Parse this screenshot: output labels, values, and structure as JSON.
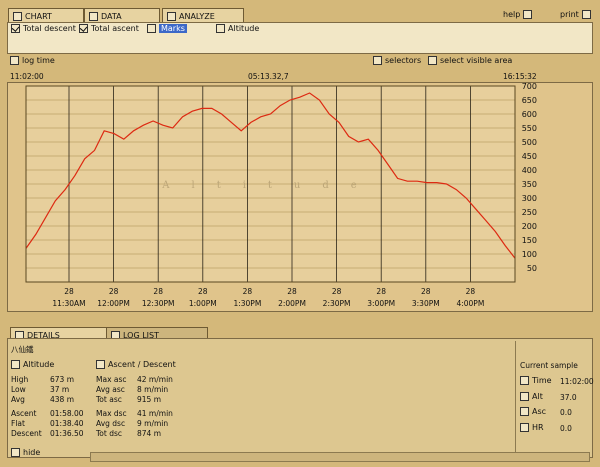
{
  "tabs": [
    {
      "label": "CHART",
      "icon": "chart-icon"
    },
    {
      "label": "DATA",
      "icon": "table-icon"
    },
    {
      "label": "ANALYZE",
      "icon": "analyze-icon"
    }
  ],
  "top_right": {
    "help": "help",
    "print": "print"
  },
  "toggles": [
    {
      "label": "Total descent"
    },
    {
      "label": "Total ascent"
    },
    {
      "label": "Marks"
    },
    {
      "label": "Altitude"
    }
  ],
  "log_time": "log time",
  "selectors": "selectors",
  "select_visible_area": "select visible area",
  "time_start": "11:02:00",
  "time_mid": "05:13.32,7",
  "time_end": "16:15:32",
  "chart_data": {
    "type": "line",
    "watermark": "Altitude",
    "series": [
      {
        "name": "Altitude",
        "color": "#dd2a12",
        "x": [
          0,
          2,
          4,
          6,
          8,
          10,
          12,
          14,
          16,
          18,
          20,
          22,
          24,
          26,
          28,
          30,
          32,
          34,
          36,
          38,
          40,
          42,
          44,
          46,
          48,
          50,
          52,
          54,
          56,
          58,
          60,
          62,
          64,
          66,
          68,
          70,
          72,
          74,
          76,
          78,
          80,
          82,
          84,
          86,
          88,
          90,
          92,
          94,
          96,
          98,
          100
        ],
        "y": [
          120,
          170,
          230,
          290,
          330,
          380,
          440,
          470,
          540,
          530,
          510,
          540,
          560,
          575,
          560,
          550,
          590,
          610,
          620,
          620,
          600,
          570,
          540,
          570,
          590,
          600,
          630,
          650,
          660,
          675,
          650,
          600,
          570,
          520,
          500,
          510,
          470,
          420,
          370,
          360,
          360,
          355,
          355,
          350,
          330,
          300,
          260,
          220,
          180,
          130,
          85
        ]
      }
    ],
    "ylim": [
      0,
      700
    ],
    "y_ticks": [
      "700",
      "650",
      "600",
      "550",
      "500",
      "450",
      "400",
      "350",
      "300",
      "250",
      "200",
      "150",
      "100",
      "50"
    ],
    "x_ticks": [
      {
        "day": "28",
        "time": "11:30AM"
      },
      {
        "day": "28",
        "time": "12:00PM"
      },
      {
        "day": "28",
        "time": "12:30PM"
      },
      {
        "day": "28",
        "time": "1:00PM"
      },
      {
        "day": "28",
        "time": "1:30PM"
      },
      {
        "day": "28",
        "time": "2:00PM"
      },
      {
        "day": "28",
        "time": "2:30PM"
      },
      {
        "day": "28",
        "time": "3:00PM"
      },
      {
        "day": "28",
        "time": "3:30PM"
      },
      {
        "day": "28",
        "time": "4:00PM"
      }
    ],
    "x_tick_days_extra": [
      "28",
      "28",
      "28",
      "28",
      "28",
      "28",
      "28",
      "28",
      "28",
      "28"
    ]
  },
  "bottom_tabs": [
    {
      "label": "DETAILS"
    },
    {
      "label": "LOG LIST"
    }
  ],
  "details": {
    "name": "八仙鐵",
    "altitude_title": "Altitude",
    "ascdesc_title": "Ascent / Descent",
    "alt_rows": [
      {
        "k": "High",
        "v": "673 m"
      },
      {
        "k": "Low",
        "v": "37 m"
      },
      {
        "k": "Avg",
        "v": "438 m"
      }
    ],
    "time_rows": [
      {
        "k": "Ascent",
        "v": "01:58.00"
      },
      {
        "k": "Flat",
        "v": "01:38.40"
      },
      {
        "k": "Descent",
        "v": "01:36.50"
      }
    ],
    "asc_rows": [
      {
        "k": "Max asc",
        "v": "42 m/min"
      },
      {
        "k": "Avg asc",
        "v": "8 m/min"
      },
      {
        "k": "Tot asc",
        "v": "915 m"
      }
    ],
    "dsc_rows": [
      {
        "k": "Max dsc",
        "v": "41 m/min"
      },
      {
        "k": "Avg dsc",
        "v": "9 m/min"
      },
      {
        "k": "Tot dsc",
        "v": "874 m"
      }
    ]
  },
  "current_sample": {
    "title": "Current sample",
    "rows": [
      {
        "k": "Time",
        "v": "11:02:00"
      },
      {
        "k": "Alt",
        "v": "37.0"
      },
      {
        "k": "Asc",
        "v": "0.0"
      },
      {
        "k": "HR",
        "v": "0.0"
      }
    ]
  },
  "hide": "hide"
}
